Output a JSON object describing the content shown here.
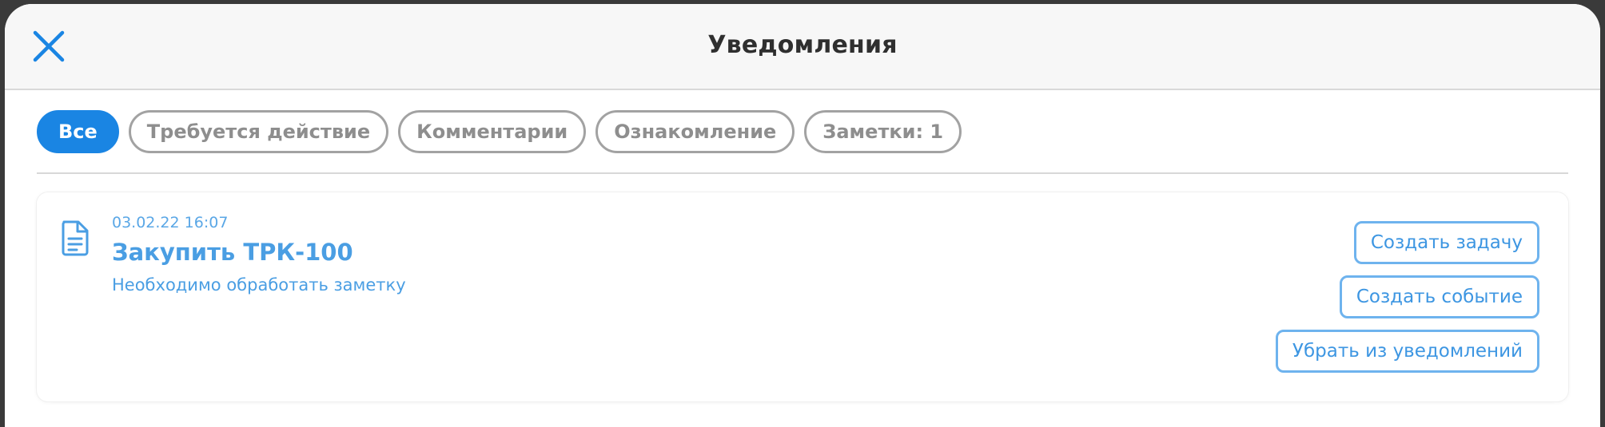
{
  "header": {
    "title": "Уведомления",
    "close_icon": "close-icon"
  },
  "filters": [
    {
      "label": "Все",
      "active": true
    },
    {
      "label": "Требуется действие",
      "active": false
    },
    {
      "label": "Комментарии",
      "active": false
    },
    {
      "label": "Ознакомление",
      "active": false
    },
    {
      "label": "Заметки: 1",
      "active": false
    }
  ],
  "notification": {
    "icon": "document-icon",
    "timestamp": "03.02.22 16:07",
    "title": "Закупить ТРК-100",
    "subtitle": "Необходимо обработать заметку",
    "actions": {
      "create_task": "Создать задачу",
      "create_event": "Создать событие",
      "remove": "Убрать из уведомлений"
    }
  },
  "colors": {
    "accent": "#1a85e3",
    "link": "#4a9ee3",
    "chip_border": "#a2a2a2"
  }
}
